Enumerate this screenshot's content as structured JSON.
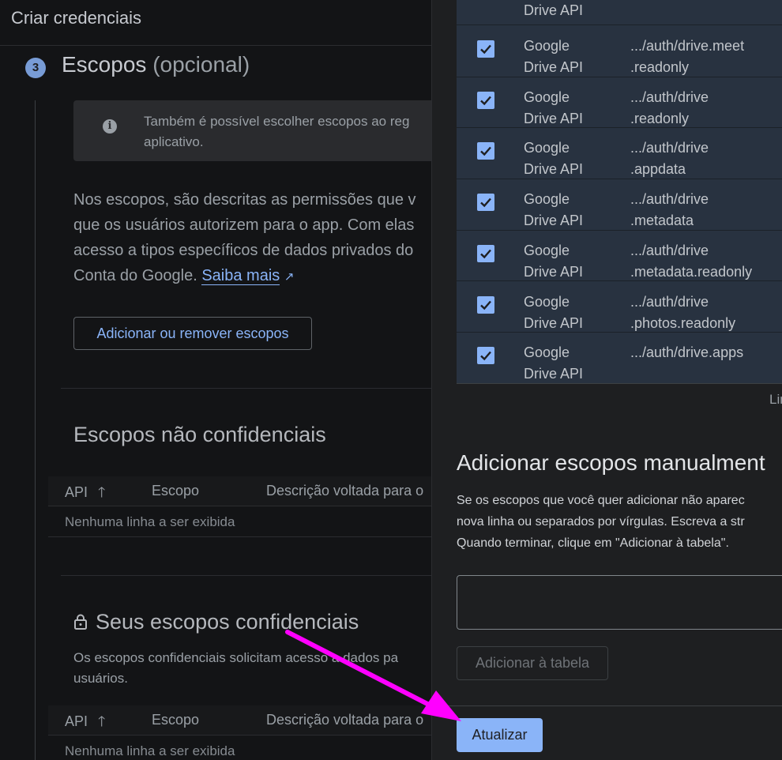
{
  "page": {
    "title": "Criar credenciais",
    "step_number": "3",
    "step_title": "Escopos",
    "step_title_optional": "(opcional)",
    "info_text": "Também é possível escolher escopos ao reg aplicativo.",
    "info_icon": "info-icon",
    "description": "Nos escopos, são descritas as permissões que v que os usuários autorizem para o app. Com elas acesso a tipos específicos de dados privados do Conta do Google.",
    "learn_more": "Saiba mais",
    "add_remove_button": "Adicionar ou remover escopos",
    "nonconfidential": {
      "title": "Escopos não confidenciais",
      "columns": [
        "API",
        "Escopo",
        "Descrição voltada para o"
      ],
      "empty_text": "Nenhuma linha a ser exibida"
    },
    "confidential": {
      "title": "Seus escopos confidenciais",
      "description": "Os escopos confidenciais solicitam acesso a dados pa usuários.",
      "columns": [
        "API",
        "Escopo",
        "Descrição voltada para o"
      ],
      "empty_text": "Nenhuma linha a ser exibida"
    }
  },
  "dialog": {
    "top_row_api": "Drive API",
    "scopes": [
      {
        "api_line1": "Google",
        "api_line2": "Drive API",
        "scope_line1": ".../auth/drive.meet",
        "scope_line2": ".readonly",
        "checked": true
      },
      {
        "api_line1": "Google",
        "api_line2": "Drive API",
        "scope_line1": ".../auth/drive",
        "scope_line2": ".readonly",
        "checked": true
      },
      {
        "api_line1": "Google",
        "api_line2": "Drive API",
        "scope_line1": ".../auth/drive",
        "scope_line2": ".appdata",
        "checked": true
      },
      {
        "api_line1": "Google",
        "api_line2": "Drive API",
        "scope_line1": ".../auth/drive",
        "scope_line2": ".metadata",
        "checked": true
      },
      {
        "api_line1": "Google",
        "api_line2": "Drive API",
        "scope_line1": ".../auth/drive",
        "scope_line2": ".metadata.readonly",
        "checked": true
      },
      {
        "api_line1": "Google",
        "api_line2": "Drive API",
        "scope_line1": ".../auth/drive",
        "scope_line2": ".photos.readonly",
        "checked": true
      },
      {
        "api_line1": "Google",
        "api_line2": "Drive API",
        "scope_line1": ".../auth/drive.apps",
        "scope_line2": "",
        "checked": true
      }
    ],
    "rows_label": "Lin",
    "manual_title": "Adicionar escopos manualment",
    "manual_desc_line1": "Se os escopos que você quer adicionar não aparec",
    "manual_desc_line2": "nova linha ou separados por vírgulas. Escreva a str",
    "manual_desc_line3": "Quando terminar, clique em \"Adicionar à tabela\".",
    "manual_input_value": "",
    "add_to_table_button": "Adicionar à tabela",
    "update_button": "Atualizar"
  },
  "colors": {
    "accent": "#8ab4f8",
    "annotation_arrow": "#ff00ff"
  }
}
